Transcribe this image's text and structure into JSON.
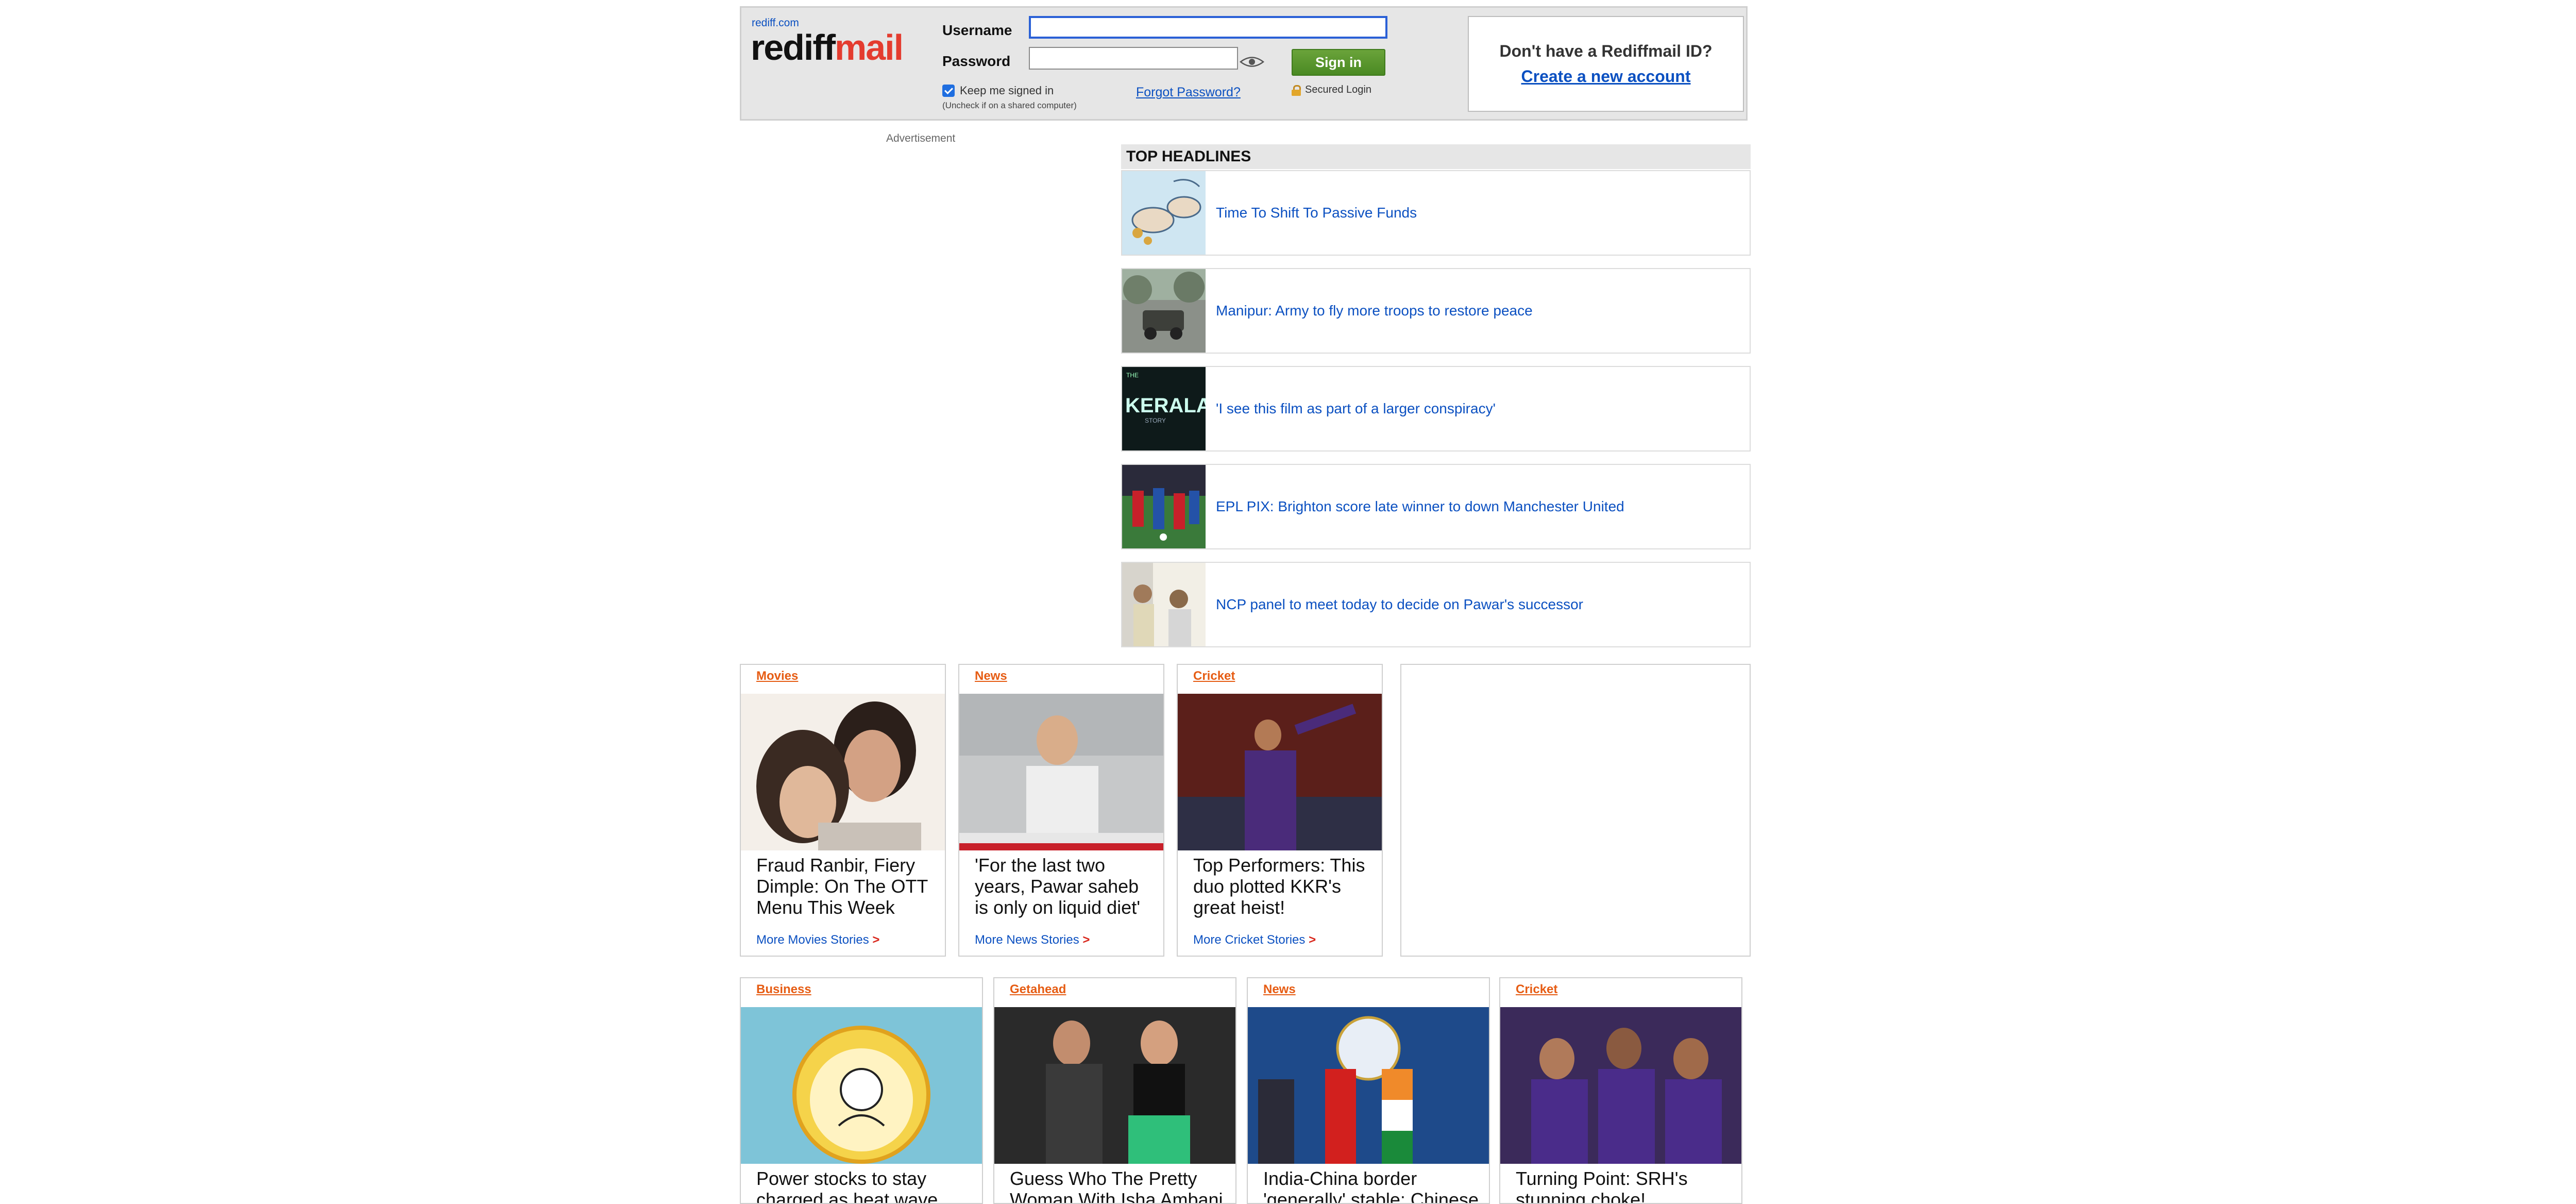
{
  "login": {
    "site_link": "rediff.com",
    "logo_part1": "rediff",
    "logo_part2": "mail",
    "username_label": "Username",
    "username_value": "",
    "password_label": "Password",
    "password_value": "",
    "signin_label": "Sign in",
    "keep_signed_in": "Keep me signed in",
    "uncheck_note": "(Uncheck if on a shared computer)",
    "forgot_password": "Forgot Password?",
    "secured_login": "Secured Login"
  },
  "signup": {
    "question": "Don't have a Rediffmail ID?",
    "link": "Create a new account"
  },
  "advertisement_label": "Advertisement",
  "top_headlines": {
    "title": "TOP HEADLINES",
    "items": [
      {
        "text": "Time To Shift To Passive Funds",
        "thumb": "piggy-bank-illustration"
      },
      {
        "text": "Manipur: Army to fly more troops to restore peace",
        "thumb": "army-vehicle-photo"
      },
      {
        "text": "'I see this film as part of a larger conspiracy'",
        "thumb": "kerala-story-poster"
      },
      {
        "text": "EPL PIX: Brighton score late winner to down Manchester United",
        "thumb": "football-match-photo"
      },
      {
        "text": "NCP panel to meet today to decide on Pawar's successor",
        "thumb": "ncp-meeting-photo"
      }
    ]
  },
  "cards_row1": [
    {
      "category": "Movies",
      "title_lines": [
        "Fraud Ranbir, Fiery",
        "Dimple: On The OTT",
        "Menu This Week"
      ],
      "more": "More Movies Stories",
      "more_arrow": ">"
    },
    {
      "category": "News",
      "title_lines": [
        "'For the last two",
        "years, Pawar saheb",
        "is only on liquid diet'"
      ],
      "more": "More News Stories",
      "more_arrow": ">"
    },
    {
      "category": "Cricket",
      "title_lines": [
        "Top Performers: This",
        "duo plotted KKR's",
        "great heist!"
      ],
      "more": "More Cricket Stories",
      "more_arrow": ">"
    }
  ],
  "cards_row2": [
    {
      "category": "Business",
      "title_lines": [
        "Power stocks to stay",
        "charged as heat wave"
      ]
    },
    {
      "category": "Getahead",
      "title_lines": [
        "Guess Who The Pretty",
        "Woman With Isha Ambani"
      ]
    },
    {
      "category": "News",
      "title_lines": [
        "India-China border",
        "'generally' stable: Chinese"
      ]
    },
    {
      "category": "Cricket",
      "title_lines": [
        "Turning Point: SRH's",
        "stunning choke!"
      ]
    }
  ],
  "colors": {
    "link_blue": "#0b50c1",
    "category_orange": "#e65c13",
    "signin_green": "#4a8a23",
    "logo_red": "#e43c2f"
  }
}
